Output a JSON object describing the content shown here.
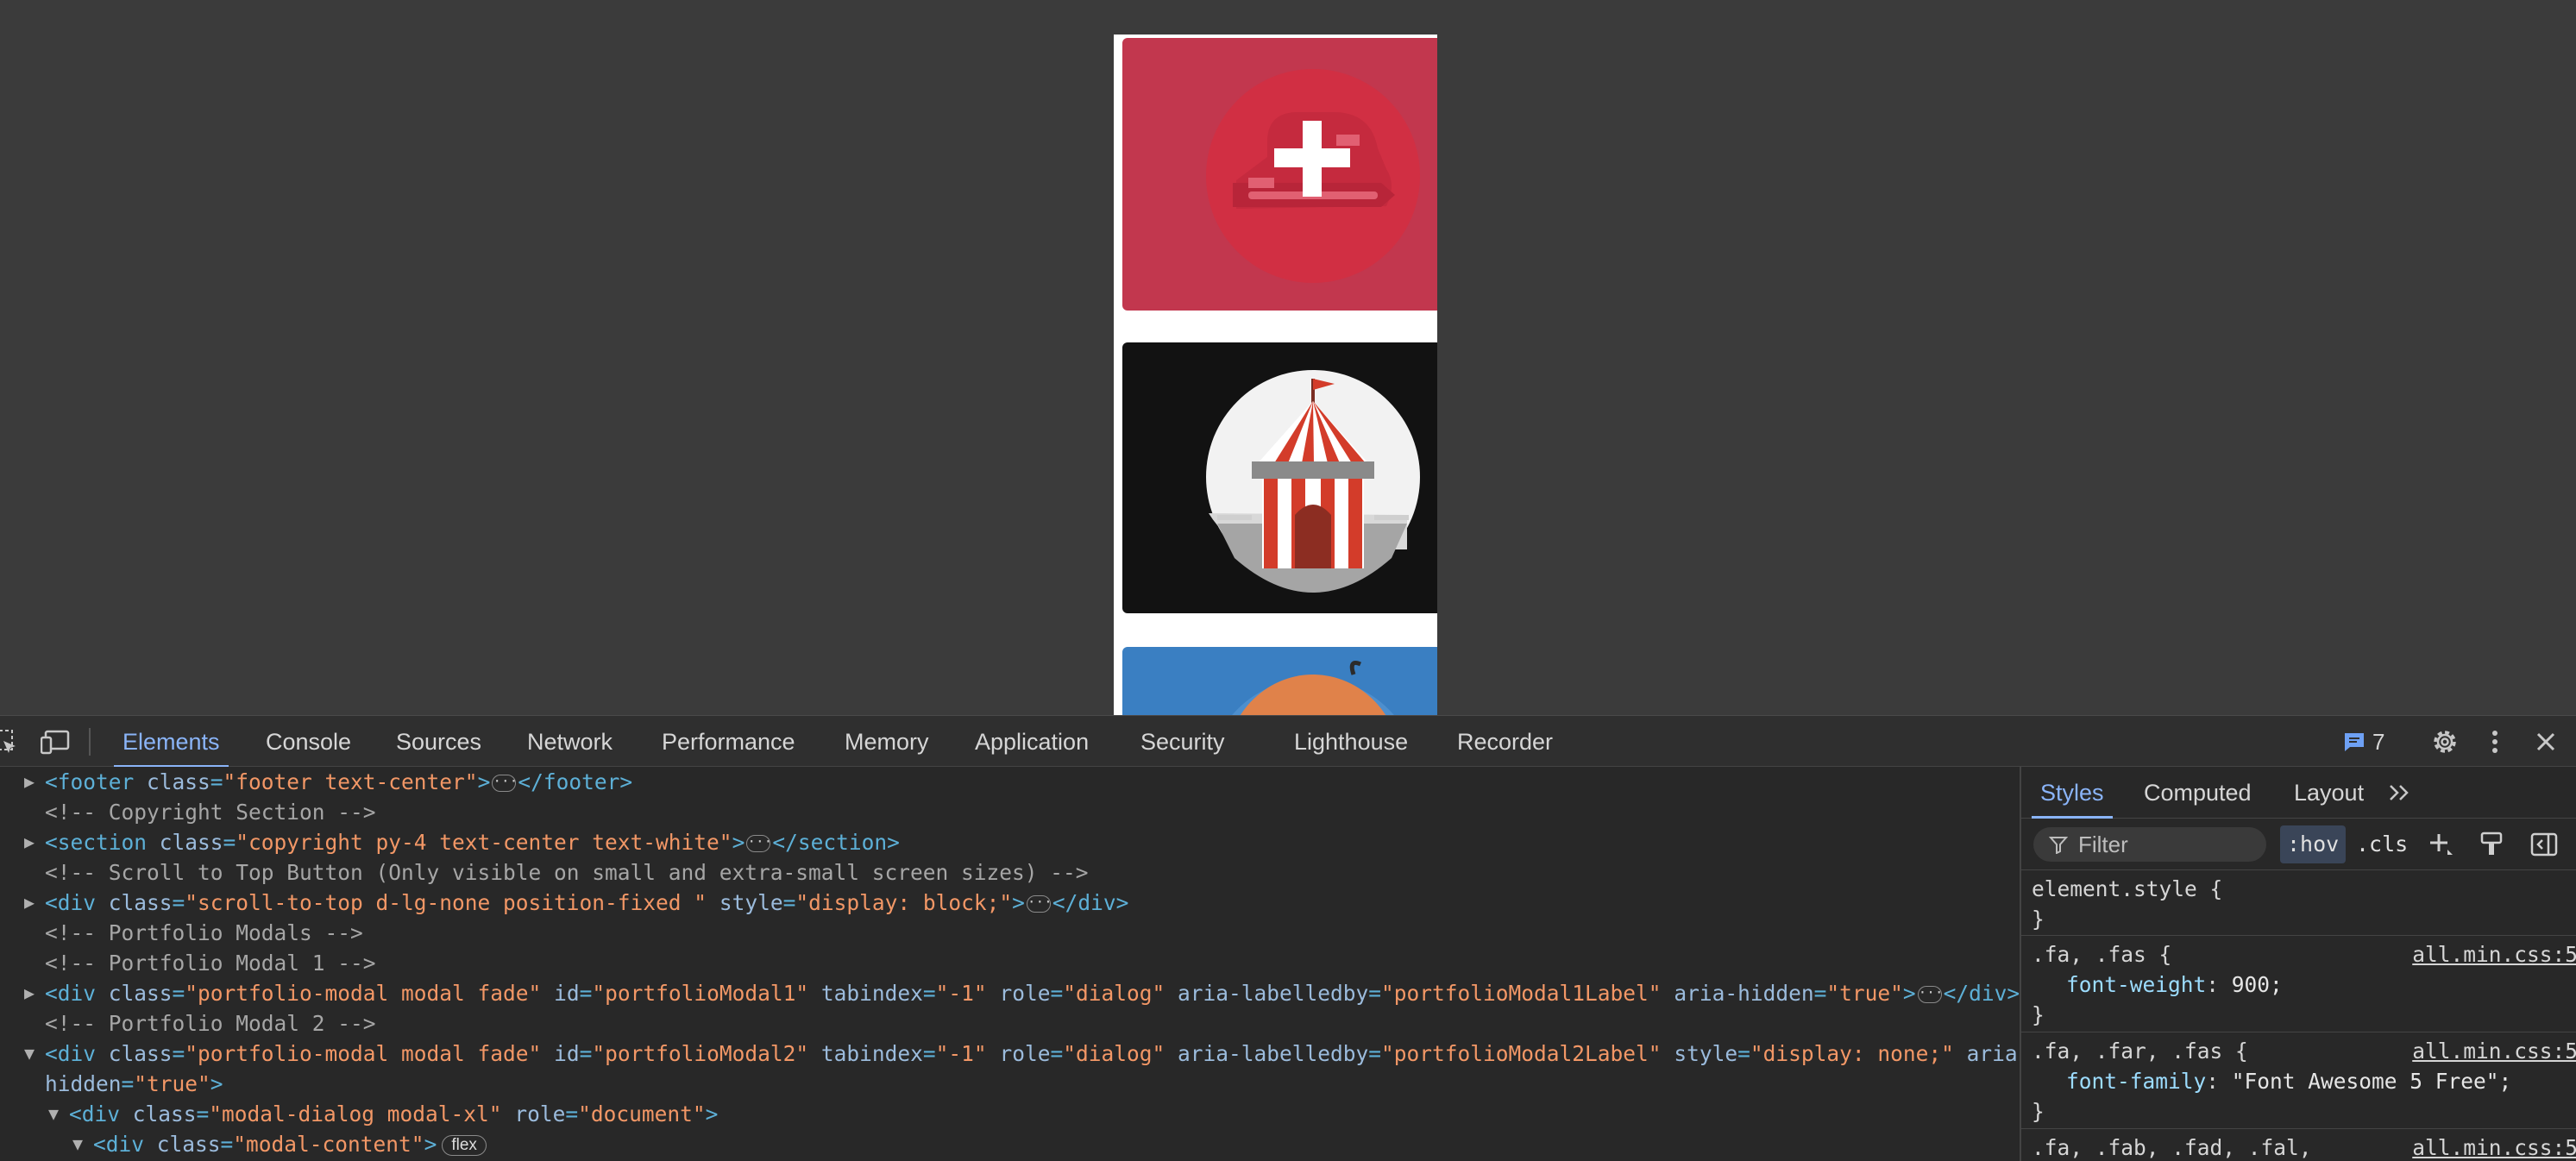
{
  "devtools": {
    "toolbar": {
      "tabs": [
        "Elements",
        "Console",
        "Sources",
        "Network",
        "Performance",
        "Memory",
        "Application",
        "Security",
        "Lighthouse",
        "Recorder"
      ],
      "active_tab": "Elements",
      "issues_count": "7",
      "icons": [
        "inspect-element-icon",
        "device-toolbar-icon",
        "issues-icon",
        "settings-gear-icon",
        "more-options-icon",
        "close-icon"
      ]
    },
    "elements": {
      "lines": [
        {
          "segments": [
            [
              "tag",
              "<footer "
            ],
            [
              "attr",
              "class"
            ],
            [
              "tag",
              "="
            ],
            [
              "val",
              "\"footer text-center\""
            ],
            [
              "tag",
              ">"
            ]
          ],
          "ellipsis": true,
          "after": [
            [
              "tag",
              "</footer>"
            ]
          ]
        },
        {
          "segments": [
            [
              "cm",
              "<!-- Copyright Section -->"
            ]
          ]
        },
        {
          "segments": [
            [
              "tag",
              "<section "
            ],
            [
              "attr",
              "class"
            ],
            [
              "tag",
              "="
            ],
            [
              "val",
              "\"copyright py-4 text-center text-white\""
            ],
            [
              "tag",
              ">"
            ]
          ],
          "ellipsis": true,
          "after": [
            [
              "tag",
              "</section>"
            ]
          ]
        },
        {
          "segments": [
            [
              "cm",
              "<!-- Scroll to Top Button (Only visible on small and extra-small screen sizes) -->"
            ]
          ]
        },
        {
          "segments": [
            [
              "tag",
              "<div "
            ],
            [
              "attr",
              "class"
            ],
            [
              "tag",
              "="
            ],
            [
              "val",
              "\"scroll-to-top d-lg-none position-fixed \""
            ],
            [
              "txt",
              " "
            ],
            [
              "attr",
              "style"
            ],
            [
              "tag",
              "="
            ],
            [
              "val",
              "\"display: block;\""
            ],
            [
              "tag",
              ">"
            ]
          ],
          "ellipsis": true,
          "after": [
            [
              "tag",
              "</div>"
            ]
          ]
        },
        {
          "segments": [
            [
              "cm",
              "<!-- Portfolio Modals -->"
            ]
          ]
        },
        {
          "segments": [
            [
              "cm",
              "<!-- Portfolio Modal 1 -->"
            ]
          ]
        },
        {
          "segments": [
            [
              "tag",
              "<div "
            ],
            [
              "attr",
              "class"
            ],
            [
              "tag",
              "="
            ],
            [
              "val",
              "\"portfolio-modal modal fade\""
            ],
            [
              "txt",
              " "
            ],
            [
              "attr",
              "id"
            ],
            [
              "tag",
              "="
            ],
            [
              "val",
              "\"portfolioModal1\""
            ],
            [
              "txt",
              " "
            ],
            [
              "attr",
              "tabindex"
            ],
            [
              "tag",
              "="
            ],
            [
              "val",
              "\"-1\""
            ],
            [
              "txt",
              " "
            ],
            [
              "attr",
              "role"
            ],
            [
              "tag",
              "="
            ],
            [
              "val",
              "\"dialog\""
            ],
            [
              "txt",
              " "
            ],
            [
              "attr",
              "aria-labelledby"
            ],
            [
              "tag",
              "="
            ],
            [
              "val",
              "\"portfolioModal1Label\""
            ],
            [
              "txt",
              " "
            ],
            [
              "attr",
              "aria-hidden"
            ],
            [
              "tag",
              "="
            ],
            [
              "val",
              "\"true\""
            ],
            [
              "tag",
              ">"
            ]
          ],
          "ellipsis": true,
          "after": [
            [
              "tag",
              "</div>"
            ]
          ]
        },
        {
          "segments": [
            [
              "cm",
              "<!-- Portfolio Modal 2 -->"
            ]
          ]
        },
        {
          "segments": [
            [
              "tag",
              "<div "
            ],
            [
              "attr",
              "class"
            ],
            [
              "tag",
              "="
            ],
            [
              "val",
              "\"portfolio-modal modal fade\""
            ],
            [
              "txt",
              " "
            ],
            [
              "attr",
              "id"
            ],
            [
              "tag",
              "="
            ],
            [
              "val",
              "\"portfolioModal2\""
            ],
            [
              "txt",
              " "
            ],
            [
              "attr",
              "tabindex"
            ],
            [
              "tag",
              "="
            ],
            [
              "val",
              "\"-1\""
            ],
            [
              "txt",
              " "
            ],
            [
              "attr",
              "role"
            ],
            [
              "tag",
              "="
            ],
            [
              "val",
              "\"dialog\""
            ],
            [
              "txt",
              " "
            ],
            [
              "attr",
              "aria-labelledby"
            ],
            [
              "tag",
              "="
            ],
            [
              "val",
              "\"portfolioModal2Label\""
            ],
            [
              "txt",
              " "
            ],
            [
              "attr",
              "style"
            ],
            [
              "tag",
              "="
            ],
            [
              "val",
              "\"display: none;\""
            ],
            [
              "txt",
              " "
            ],
            [
              "attr",
              "aria-"
            ]
          ]
        },
        {
          "segments": [
            [
              "attr",
              "hidden"
            ],
            [
              "tag",
              "="
            ],
            [
              "val",
              "\"true\""
            ],
            [
              "tag",
              ">"
            ]
          ]
        },
        {
          "segments": [
            [
              "tag",
              "<div "
            ],
            [
              "attr",
              "class"
            ],
            [
              "tag",
              "="
            ],
            [
              "val",
              "\"modal-dialog modal-xl\""
            ],
            [
              "txt",
              " "
            ],
            [
              "attr",
              "role"
            ],
            [
              "tag",
              "="
            ],
            [
              "val",
              "\"document\""
            ],
            [
              "tag",
              ">"
            ]
          ]
        },
        {
          "segments": [
            [
              "tag",
              "<div "
            ],
            [
              "attr",
              "class"
            ],
            [
              "tag",
              "="
            ],
            [
              "val",
              "\"modal-content\""
            ],
            [
              "tag",
              ">"
            ]
          ],
          "badge": "flex"
        }
      ],
      "triangles": [
        "right",
        "",
        "right",
        "",
        "right",
        "",
        "",
        "right",
        "",
        "down",
        "",
        "down",
        "down"
      ]
    },
    "styles": {
      "tabs": [
        "Styles",
        "Computed",
        "Layout"
      ],
      "active_tab": "Styles",
      "more_tabs_icon": "double-chevron-right-icon",
      "filter_placeholder": "Filter",
      "hov_label": ":hov",
      "cls_label": ".cls",
      "toolbar_icons": [
        "filter-funnel-icon",
        "add-rule-icon",
        "paint-brush-icon",
        "toggle-sidebar-icon"
      ],
      "rules": [
        {
          "selector": "element.style {",
          "source": "",
          "decls": [],
          "close": "}"
        },
        {
          "selector": ".fa, .fas {",
          "source": "all.min.css:5",
          "decls": [
            {
              "name": "font-weight",
              "value": "900;"
            }
          ],
          "close": "}"
        },
        {
          "selector": ".fa, .far, .fas {",
          "source": "all.min.css:5",
          "decls": [
            {
              "name": "font-family",
              "value": "\"Font Awesome 5 Free\";"
            }
          ],
          "close": "}"
        },
        {
          "selector": ".fa, .fab, .fad, .fal,",
          "source": "all.min.css:5",
          "decls": [],
          "close": ""
        }
      ]
    }
  },
  "preview": {
    "cards": [
      {
        "name": "portfolio-card-cake",
        "bg": "#c2374e"
      },
      {
        "name": "portfolio-card-circus",
        "bg": "#121212"
      },
      {
        "name": "portfolio-card-game",
        "bg": "#3a7fc2"
      }
    ]
  }
}
